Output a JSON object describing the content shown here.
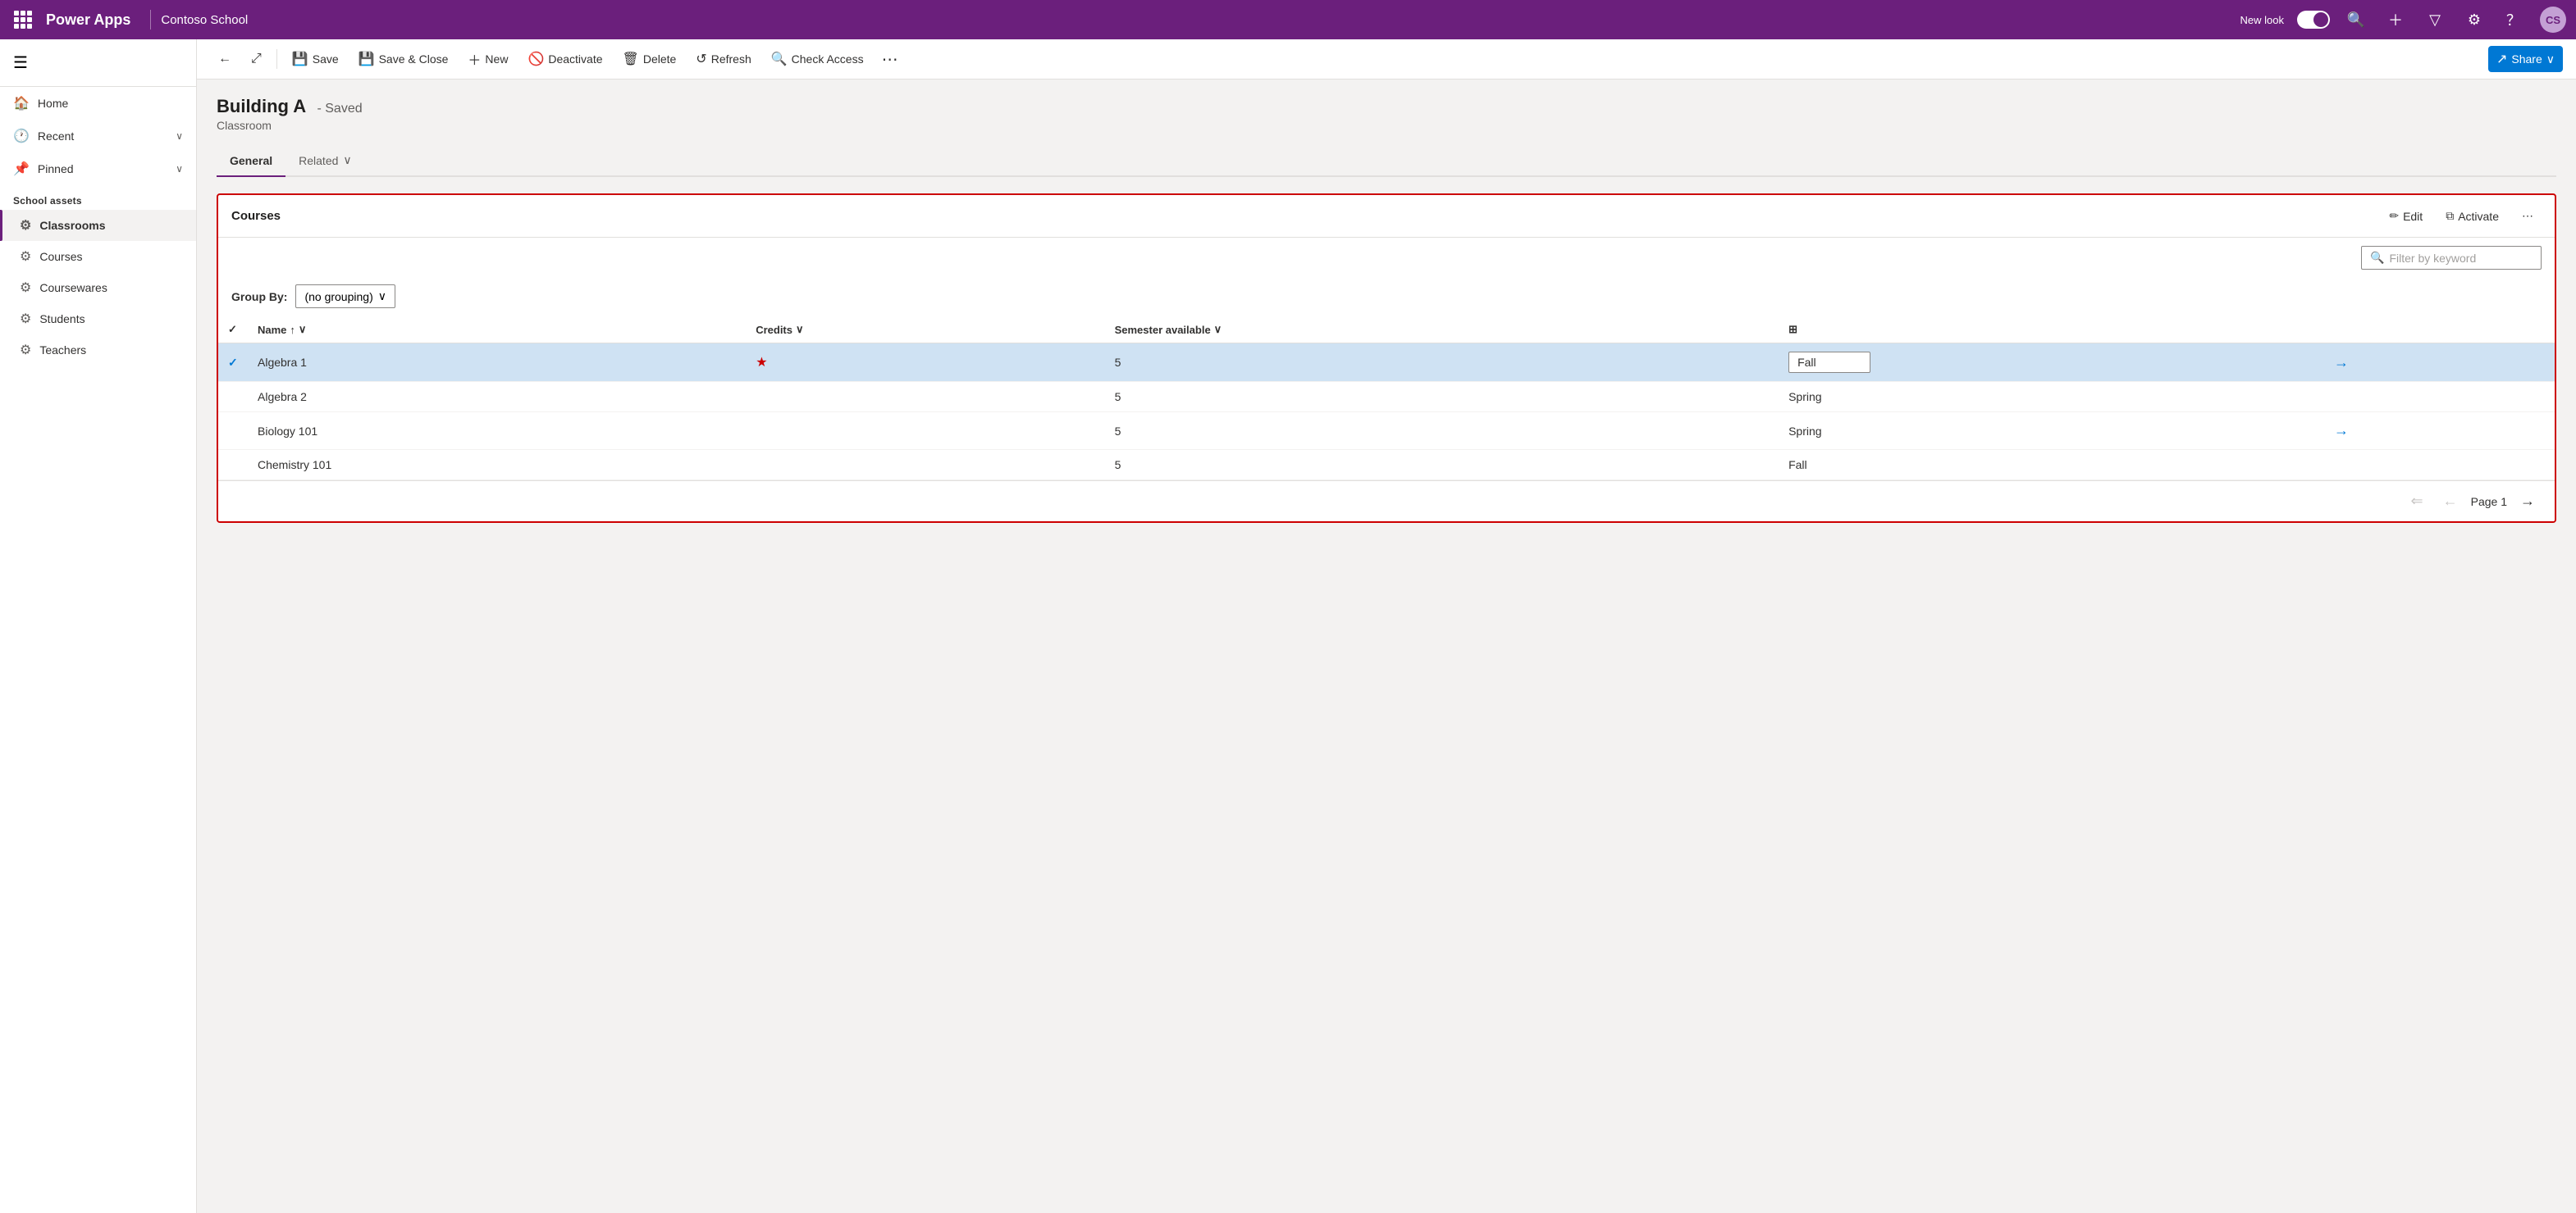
{
  "app": {
    "name": "Power Apps",
    "context": "Contoso School",
    "new_look_label": "New look",
    "avatar_initials": "CS"
  },
  "sidebar": {
    "nav_items": [
      {
        "id": "home",
        "label": "Home",
        "icon": "🏠"
      },
      {
        "id": "recent",
        "label": "Recent",
        "icon": "🕐",
        "has_chevron": true
      },
      {
        "id": "pinned",
        "label": "Pinned",
        "icon": "📌",
        "has_chevron": true
      }
    ],
    "section_label": "School assets",
    "sub_items": [
      {
        "id": "classrooms",
        "label": "Classrooms",
        "icon": "⚙",
        "active": true
      },
      {
        "id": "courses",
        "label": "Courses",
        "icon": "⚙",
        "active": false
      },
      {
        "id": "coursewares",
        "label": "Coursewares",
        "icon": "⚙",
        "active": false
      },
      {
        "id": "students",
        "label": "Students",
        "icon": "⚙",
        "active": false
      },
      {
        "id": "teachers",
        "label": "Teachers",
        "icon": "⚙",
        "active": false
      }
    ]
  },
  "toolbar": {
    "back_label": "",
    "restore_label": "",
    "save_label": "Save",
    "save_close_label": "Save & Close",
    "new_label": "New",
    "deactivate_label": "Deactivate",
    "delete_label": "Delete",
    "refresh_label": "Refresh",
    "check_access_label": "Check Access",
    "more_label": "⋯",
    "share_label": "Share"
  },
  "record": {
    "title": "Building A",
    "saved_badge": "- Saved",
    "subtitle": "Classroom"
  },
  "tabs": [
    {
      "id": "general",
      "label": "General",
      "active": true
    },
    {
      "id": "related",
      "label": "Related",
      "active": false
    }
  ],
  "courses_section": {
    "title": "Courses",
    "edit_label": "Edit",
    "activate_label": "Activate",
    "more_label": "⋯",
    "filter_placeholder": "Filter by keyword",
    "group_by_label": "Group By:",
    "group_by_value": "(no grouping)",
    "columns": [
      {
        "id": "name",
        "label": "Name",
        "sortable": true
      },
      {
        "id": "credits",
        "label": "Credits",
        "sortable": true
      },
      {
        "id": "semester",
        "label": "Semester available",
        "sortable": true
      }
    ],
    "rows": [
      {
        "id": 1,
        "name": "Algebra 1",
        "credits": 5,
        "semester": "Fall",
        "selected": true,
        "has_arrow": true,
        "has_star": true
      },
      {
        "id": 2,
        "name": "Algebra 2",
        "credits": 5,
        "semester": "Spring",
        "selected": false,
        "has_arrow": false,
        "has_star": false
      },
      {
        "id": 3,
        "name": "Biology 101",
        "credits": 5,
        "semester": "Spring",
        "selected": false,
        "has_arrow": true,
        "has_star": false
      },
      {
        "id": 4,
        "name": "Chemistry 101",
        "credits": 5,
        "semester": "Fall",
        "selected": false,
        "has_arrow": false,
        "has_star": false
      }
    ],
    "pagination": {
      "page_label": "Page 1"
    }
  }
}
